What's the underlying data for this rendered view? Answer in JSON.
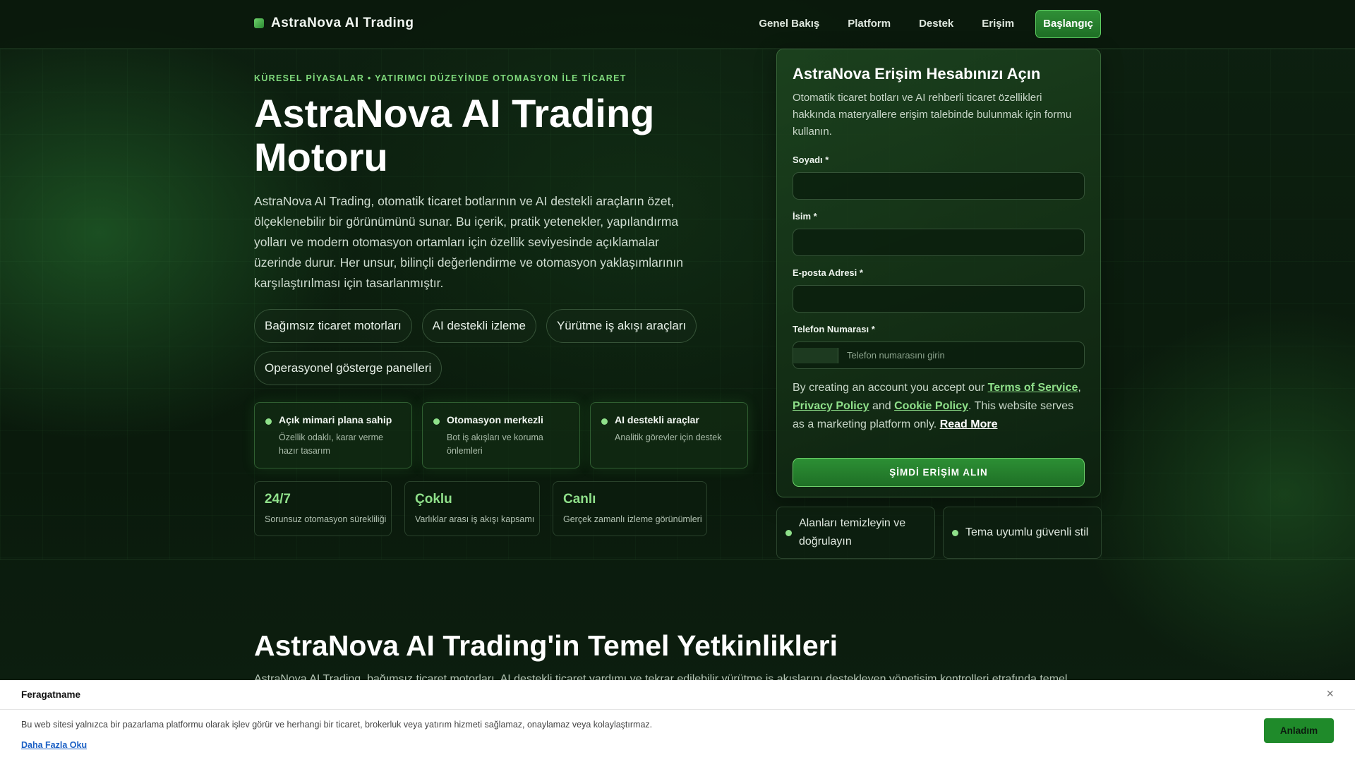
{
  "header": {
    "brand": "AstraNova AI Trading",
    "nav": [
      "Genel Bakış",
      "Platform",
      "Destek",
      "Erişim"
    ],
    "cta": "Başlangıç"
  },
  "hero": {
    "eyebrow": "KÜRESEL PİYASALAR • YATIRIMCI DÜZEYİNDE OTOMASYON İLE TİCARET",
    "title": "AstraNova AI Trading Motoru",
    "description": "AstraNova AI Trading, otomatik ticaret botlarının ve AI destekli araçların özet, ölçeklenebilir bir görünümünü sunar. Bu içerik, pratik yetenekler, yapılandırma yolları ve modern otomasyon ortamları için özellik seviyesinde açıklamalar üzerinde durur. Her unsur, bilinçli değerlendirme ve otomasyon yaklaşımlarının karşılaştırılması için tasarlanmıştır.",
    "chips": [
      "Bağımsız ticaret motorları",
      "AI destekli izleme",
      "Yürütme iş akışı araçları",
      "Operasyonel gösterge panelleri"
    ],
    "features": [
      {
        "title": "Açık mimari plana sahip",
        "desc": "Özellik odaklı, karar verme hazır tasarım"
      },
      {
        "title": "Otomasyon merkezli",
        "desc": "Bot iş akışları ve koruma önlemleri"
      },
      {
        "title": "AI destekli araçlar",
        "desc": "Analitik görevler için destek"
      }
    ],
    "stats": [
      {
        "value": "24/7",
        "label": "Sorunsuz otomasyon sürekliliği"
      },
      {
        "value": "Çoklu",
        "label": "Varlıklar arası iş akışı kapsamı"
      },
      {
        "value": "Canlı",
        "label": "Gerçek zamanlı izleme görünümleri"
      }
    ]
  },
  "form": {
    "title": "AstraNova Erişim Hesabınızı Açın",
    "subtitle": "Otomatik ticaret botları ve AI rehberli ticaret özellikleri hakkında materyallere erişim talebinde bulunmak için formu kullanın.",
    "last_name_label": "Soyadı *",
    "first_name_label": "İsim *",
    "email_label": "E-posta Adresi *",
    "phone_label": "Telefon Numarası *",
    "phone_placeholder": "Telefon numarasını girin",
    "terms_prefix": "By creating an account you accept our ",
    "terms_link": "Terms of Service",
    "comma": ",",
    "privacy_link": "Privacy Policy",
    "and": " and ",
    "cookie_link": "Cookie Policy",
    "terms_suffix": ". This website serves as a marketing platform only. ",
    "read_more": "Read More",
    "submit": "ŞİMDİ ERİŞİM ALIN"
  },
  "mini_cards": [
    "Alanları temizleyin ve doğrulayın",
    "Tema uyumlu güvenli stil"
  ],
  "section": {
    "title": "AstraNova AI Trading'in Temel Yetkinlikleri",
    "desc": "AstraNova AI Trading, bağımsız ticaret motorları, AI destekli ticaret yardımı ve tekrar edilebilir yürütme iş akışlarını destekleyen yönetişim kontrolleri etrafında temel"
  },
  "disclaimer": {
    "title": "Feragatname",
    "text": "Bu web sitesi yalnızca bir pazarlama platformu olarak işlev görür ve herhangi bir ticaret, brokerluk veya yatırım hizmeti sağlamaz, onaylamaz veya kolaylaştırmaz.",
    "link": "Daha Fazla Oku",
    "button": "Anladım",
    "close": "×"
  },
  "colors": {
    "accent": "#8fe08a",
    "button_green": "#1f8a2a",
    "background": "#0b1a0e"
  }
}
